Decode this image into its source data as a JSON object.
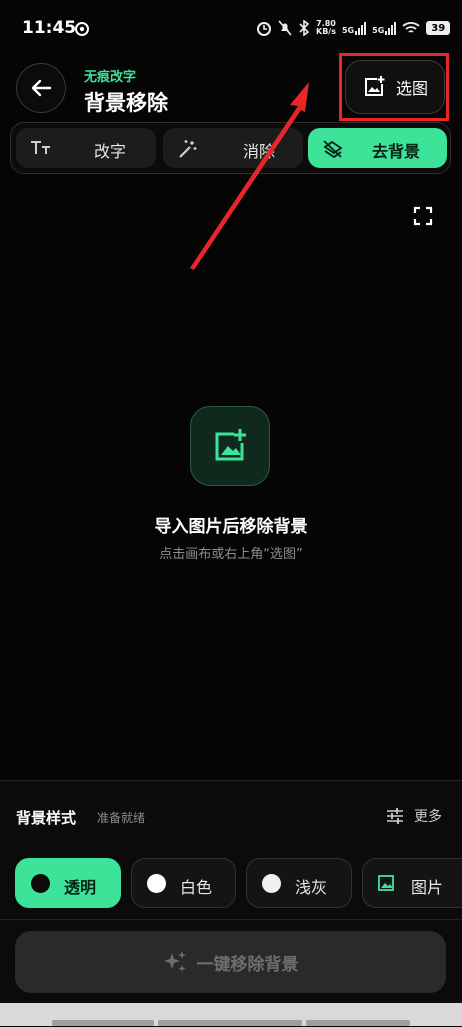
{
  "status_bar": {
    "time": "11:45",
    "speed_value": "7.80",
    "speed_unit": "KB/s",
    "net1": "5G",
    "net2": "5G",
    "battery": "39"
  },
  "header": {
    "app_name": "无痕改字",
    "title": "背景移除",
    "pick_image_label": "选图"
  },
  "tabs": [
    {
      "label": "改字",
      "icon": "text-size-icon",
      "active": false
    },
    {
      "label": "消除",
      "icon": "magic-wand-icon",
      "active": false
    },
    {
      "label": "去背景",
      "icon": "remove-background-icon",
      "active": true
    }
  ],
  "canvas": {
    "empty_title": "导入图片后移除背景",
    "empty_subtitle": "点击画布或右上角“选图”"
  },
  "panel": {
    "title": "背景样式",
    "status": "准备就绪",
    "more_label": "更多",
    "options": [
      {
        "label": "透明",
        "selected": true
      },
      {
        "label": "白色",
        "selected": false
      },
      {
        "label": "浅灰",
        "selected": false
      },
      {
        "label": "图片",
        "selected": false
      }
    ],
    "action_label": "一键移除背景"
  },
  "colors": {
    "accent": "#3ee39a",
    "background": "#050505",
    "highlight_box": "#e8262a",
    "annotation_arrow": "#e8262a"
  }
}
